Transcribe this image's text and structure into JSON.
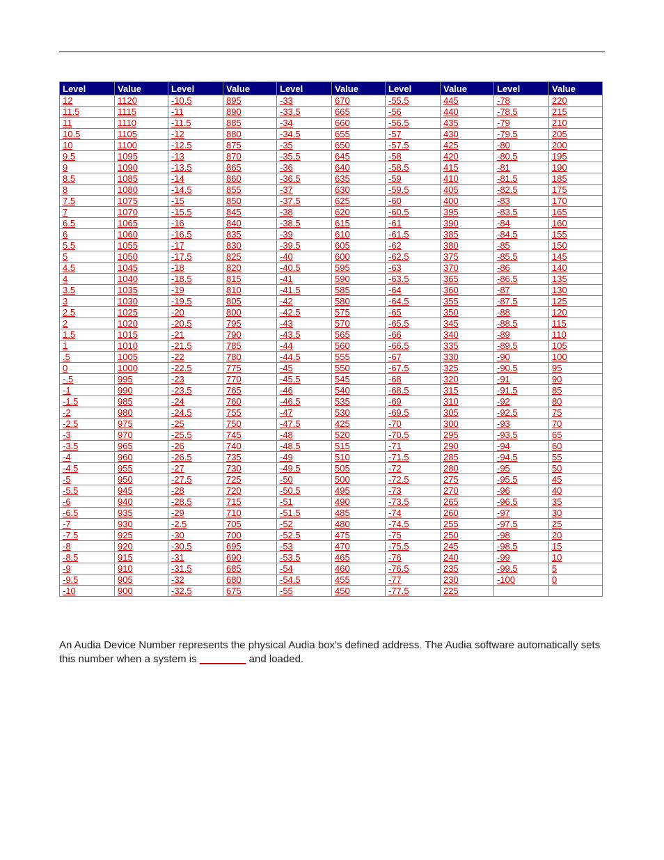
{
  "headers": [
    "Level",
    "Value",
    "Level",
    "Value",
    "Level",
    "Value",
    "Level",
    "Value",
    "Level",
    "Value"
  ],
  "tablePairs": [
    [
      [
        "12",
        "1120"
      ],
      [
        "-10.5",
        "895"
      ],
      [
        "-33",
        "670"
      ],
      [
        "-55.5",
        "445"
      ],
      [
        "-78",
        "220"
      ]
    ],
    [
      [
        "11.5",
        "1115"
      ],
      [
        "-11",
        "890"
      ],
      [
        "-33.5",
        "665"
      ],
      [
        "-56",
        "440"
      ],
      [
        "-78.5",
        "215"
      ]
    ],
    [
      [
        "11",
        "1110"
      ],
      [
        "-11.5",
        "885"
      ],
      [
        "-34",
        "660"
      ],
      [
        "-56.5",
        "435"
      ],
      [
        "-79",
        "210"
      ]
    ],
    [
      [
        "10.5",
        "1105"
      ],
      [
        "-12",
        "880"
      ],
      [
        "-34.5",
        "655"
      ],
      [
        "-57",
        "430"
      ],
      [
        "-79.5",
        "205"
      ]
    ],
    [
      [
        "10",
        "1100"
      ],
      [
        "-12.5",
        "875"
      ],
      [
        "-35",
        "650"
      ],
      [
        "-57.5",
        "425"
      ],
      [
        "-80",
        "200"
      ]
    ],
    [
      [
        "9.5",
        "1095"
      ],
      [
        "-13",
        "870"
      ],
      [
        "-35.5",
        "645"
      ],
      [
        "-58",
        "420"
      ],
      [
        "-80.5",
        "195"
      ]
    ],
    [
      [
        "9",
        "1090"
      ],
      [
        "-13.5",
        "865"
      ],
      [
        "-36",
        "640"
      ],
      [
        "-58.5",
        "415"
      ],
      [
        "-81",
        "190"
      ]
    ],
    [
      [
        "8.5",
        "1085"
      ],
      [
        "-14",
        "860"
      ],
      [
        "-36.5",
        "635"
      ],
      [
        "-59",
        "410"
      ],
      [
        "-81.5",
        "185"
      ]
    ],
    [
      [
        "8",
        "1080"
      ],
      [
        "-14.5",
        "855"
      ],
      [
        "-37",
        "630"
      ],
      [
        "-59.5",
        "405"
      ],
      [
        "-82.5",
        "175"
      ]
    ],
    [
      [
        "7.5",
        "1075"
      ],
      [
        "-15",
        "850"
      ],
      [
        "-37.5",
        "625"
      ],
      [
        "-60",
        "400"
      ],
      [
        "-83",
        "170"
      ]
    ],
    [
      [
        "7",
        "1070"
      ],
      [
        "-15.5",
        "845"
      ],
      [
        "-38",
        "620"
      ],
      [
        "-60.5",
        "395"
      ],
      [
        "-83.5",
        "165"
      ]
    ],
    [
      [
        "6.5",
        "1065"
      ],
      [
        "-16",
        "840"
      ],
      [
        "-38.5",
        "615"
      ],
      [
        "-61",
        "390"
      ],
      [
        "-84",
        "160"
      ]
    ],
    [
      [
        "6",
        "1060"
      ],
      [
        "-16.5",
        "835"
      ],
      [
        "-39",
        "610"
      ],
      [
        "-61.5",
        "385"
      ],
      [
        "-84.5",
        "155"
      ]
    ],
    [
      [
        "5.5",
        "1055"
      ],
      [
        "-17",
        "830"
      ],
      [
        "-39.5",
        "605"
      ],
      [
        "-62",
        "380"
      ],
      [
        "-85",
        "150"
      ]
    ],
    [
      [
        "5",
        "1050"
      ],
      [
        "-17.5",
        "825"
      ],
      [
        "-40",
        "600"
      ],
      [
        "-62.5",
        "375"
      ],
      [
        "-85.5",
        "145"
      ]
    ],
    [
      [
        "4.5",
        "1045"
      ],
      [
        "-18",
        "820"
      ],
      [
        "-40.5",
        "595"
      ],
      [
        "-63",
        "370"
      ],
      [
        "-86",
        "140"
      ]
    ],
    [
      [
        "4",
        "1040"
      ],
      [
        "-18.5",
        "815"
      ],
      [
        "-41",
        "590"
      ],
      [
        "-63.5",
        "365"
      ],
      [
        "-86.5",
        "135"
      ]
    ],
    [
      [
        "3.5",
        "1035"
      ],
      [
        "-19",
        "810"
      ],
      [
        "-41.5",
        "585"
      ],
      [
        "-64",
        "360"
      ],
      [
        "-87",
        "130"
      ]
    ],
    [
      [
        "3",
        "1030"
      ],
      [
        "-19.5",
        "805"
      ],
      [
        "-42",
        "580"
      ],
      [
        "-64.5",
        "355"
      ],
      [
        "-87.5",
        "125"
      ]
    ],
    [
      [
        "2.5",
        "1025"
      ],
      [
        "-20",
        "800"
      ],
      [
        "-42.5",
        "575"
      ],
      [
        "-65",
        "350"
      ],
      [
        "-88",
        "120"
      ]
    ],
    [
      [
        "2",
        "1020"
      ],
      [
        "-20.5",
        "795"
      ],
      [
        "-43",
        "570"
      ],
      [
        "-65.5",
        "345"
      ],
      [
        "-88.5",
        "115"
      ]
    ],
    [
      [
        "1.5",
        "1015"
      ],
      [
        "-21",
        "790"
      ],
      [
        "-43.5",
        "565"
      ],
      [
        "-66",
        "340"
      ],
      [
        "-89",
        "110"
      ]
    ],
    [
      [
        "1",
        "1010"
      ],
      [
        "-21.5",
        "785"
      ],
      [
        "-44",
        "560"
      ],
      [
        "-66.5",
        "335"
      ],
      [
        "-89.5",
        "105"
      ]
    ],
    [
      [
        ".5",
        "1005"
      ],
      [
        "-22",
        "780"
      ],
      [
        "-44.5",
        "555"
      ],
      [
        "-67",
        "330"
      ],
      [
        "-90",
        "100"
      ]
    ],
    [
      [
        "0",
        "1000"
      ],
      [
        "-22.5",
        "775"
      ],
      [
        "-45",
        "550"
      ],
      [
        "-67.5",
        "325"
      ],
      [
        "-90.5",
        "95"
      ]
    ],
    [
      [
        "-.5",
        "995"
      ],
      [
        "-23",
        "770"
      ],
      [
        "-45.5",
        "545"
      ],
      [
        "-68",
        "320"
      ],
      [
        "-91",
        "90"
      ]
    ],
    [
      [
        "-1",
        "990"
      ],
      [
        "-23.5",
        "765"
      ],
      [
        "-46",
        "540"
      ],
      [
        "-68.5",
        "315"
      ],
      [
        "-91.5",
        "85"
      ]
    ],
    [
      [
        "-1.5",
        "985"
      ],
      [
        "-24",
        "760"
      ],
      [
        "-46.5",
        "535"
      ],
      [
        "-69",
        "310"
      ],
      [
        "-92",
        "80"
      ]
    ],
    [
      [
        "-2",
        "980"
      ],
      [
        "-24.5",
        "755"
      ],
      [
        "-47",
        "530"
      ],
      [
        "-69.5",
        "305"
      ],
      [
        "-92.5",
        "75"
      ]
    ],
    [
      [
        "-2.5",
        "975"
      ],
      [
        "-25",
        "750"
      ],
      [
        "-47.5",
        "425"
      ],
      [
        "-70",
        "300"
      ],
      [
        "-93",
        "70"
      ]
    ],
    [
      [
        "-3",
        "970"
      ],
      [
        "-25.5",
        "745"
      ],
      [
        "-48",
        "520"
      ],
      [
        "-70.5",
        "295"
      ],
      [
        "-93.5",
        "65"
      ]
    ],
    [
      [
        "-3.5",
        "965"
      ],
      [
        "-26",
        "740"
      ],
      [
        "-48.5",
        "515"
      ],
      [
        "-71",
        "290"
      ],
      [
        "-94",
        "60"
      ]
    ],
    [
      [
        "-4",
        "960"
      ],
      [
        "-26.5",
        "735"
      ],
      [
        "-49",
        "510"
      ],
      [
        "-71.5",
        "285"
      ],
      [
        "-94.5",
        "55"
      ]
    ],
    [
      [
        "-4.5",
        "955"
      ],
      [
        "-27",
        "730"
      ],
      [
        "-49.5",
        "505"
      ],
      [
        "-72",
        "280"
      ],
      [
        "-95",
        "50"
      ]
    ],
    [
      [
        "-5",
        "950"
      ],
      [
        "-27.5",
        "725"
      ],
      [
        "-50",
        "500"
      ],
      [
        "-72.5",
        "275"
      ],
      [
        "-95.5",
        "45"
      ]
    ],
    [
      [
        "-5.5",
        "945"
      ],
      [
        "-28",
        "720"
      ],
      [
        "-50.5",
        "495"
      ],
      [
        "-73",
        "270"
      ],
      [
        "-96",
        "40"
      ]
    ],
    [
      [
        "-6",
        "940"
      ],
      [
        "-28.5",
        "715"
      ],
      [
        "-51",
        "490"
      ],
      [
        "-73.5",
        "265"
      ],
      [
        "-96.5",
        "35"
      ]
    ],
    [
      [
        "-6.5",
        "935"
      ],
      [
        "-29",
        "710"
      ],
      [
        "-51.5",
        "485"
      ],
      [
        "-74",
        "260"
      ],
      [
        "-97",
        "30"
      ]
    ],
    [
      [
        "-7",
        "930"
      ],
      [
        "-2.5",
        "705"
      ],
      [
        "-52",
        "480"
      ],
      [
        "-74.5",
        "255"
      ],
      [
        "-97.5",
        "25"
      ]
    ],
    [
      [
        "-7.5",
        "925"
      ],
      [
        "-30",
        "700"
      ],
      [
        "-52.5",
        "475"
      ],
      [
        "-75",
        "250"
      ],
      [
        "-98",
        "20"
      ]
    ],
    [
      [
        "-8",
        "920"
      ],
      [
        "-30.5",
        "695"
      ],
      [
        "-53",
        "470"
      ],
      [
        "-75.5",
        "245"
      ],
      [
        "-98.5",
        "15"
      ]
    ],
    [
      [
        "-8.5",
        "915"
      ],
      [
        "-31",
        "690"
      ],
      [
        "-53.5",
        "465"
      ],
      [
        "-76",
        "240"
      ],
      [
        "-99",
        "10"
      ]
    ],
    [
      [
        "-9",
        "910"
      ],
      [
        "-31.5",
        "685"
      ],
      [
        "-54",
        "460"
      ],
      [
        "-76.5",
        "235"
      ],
      [
        "-99.5",
        "5"
      ]
    ],
    [
      [
        "-9.5",
        "905"
      ],
      [
        "-32",
        "680"
      ],
      [
        "-54.5",
        "455"
      ],
      [
        "-77",
        "230"
      ],
      [
        "-100",
        "0"
      ]
    ],
    [
      [
        "-10",
        "900"
      ],
      [
        "-32.5",
        "675"
      ],
      [
        "-55",
        "450"
      ],
      [
        "-77.5",
        "225"
      ],
      [
        "",
        ""
      ]
    ]
  ],
  "paragraph": {
    "pre": "An Audia Device Number represents the physical Audia box's defined address. The Audia software automatically sets this number when a system is ",
    "link": "________",
    "post": " and loaded."
  }
}
